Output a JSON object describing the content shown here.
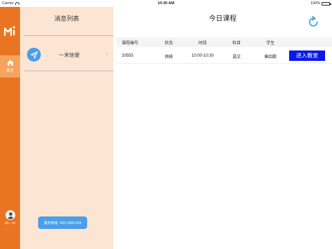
{
  "status_bar": {
    "carrier": "Carrier",
    "time": "10:30 AM",
    "battery": "100%"
  },
  "rail": {
    "home_label": "首页",
    "user_name": "zh…in"
  },
  "message_panel": {
    "title": "消息列表",
    "items": [
      {
        "label": "一米信使"
      }
    ],
    "hotline": "服务热线: 400-1820-918"
  },
  "main": {
    "title": "今日课程",
    "table": {
      "headers": [
        "课程编号",
        "状态",
        "时段",
        "科目",
        "学生"
      ],
      "rows": [
        {
          "id": "20555",
          "status": "预排",
          "time": "10:00-10:30",
          "subject": "语文",
          "student": "章四歌",
          "action": "进入教室"
        }
      ]
    }
  },
  "colors": {
    "rail": "#e97522",
    "panel": "#fde5d3",
    "accent_blue": "#4a9fe8",
    "button_blue": "#0a18e8"
  },
  "icons": {
    "logo": "yimi-logo-icon",
    "home": "home-icon",
    "plane": "paper-plane-icon",
    "refresh": "refresh-icon"
  }
}
